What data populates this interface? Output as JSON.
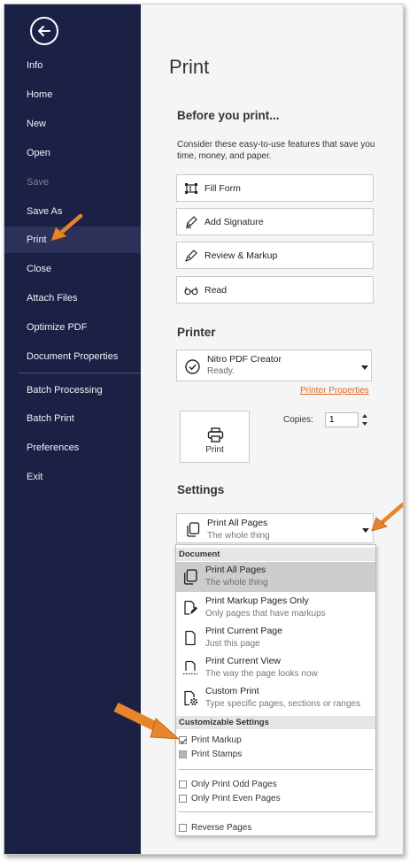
{
  "sidebar": {
    "items": [
      {
        "label": "Info"
      },
      {
        "label": "Home"
      },
      {
        "label": "New"
      },
      {
        "label": "Open"
      },
      {
        "label": "Save"
      },
      {
        "label": "Save As"
      },
      {
        "label": "Print"
      },
      {
        "label": "Close"
      },
      {
        "label": "Attach Files"
      },
      {
        "label": "Optimize PDF"
      },
      {
        "label": "Document Properties"
      },
      {
        "label": "Batch Processing"
      },
      {
        "label": "Batch Print"
      },
      {
        "label": "Preferences"
      },
      {
        "label": "Exit"
      }
    ],
    "active": "Print",
    "disabled": "Save"
  },
  "main": {
    "title": "Print",
    "before_heading": "Before you print...",
    "before_hint": "Consider these easy-to-use features that save you time, money, and paper.",
    "features": [
      {
        "label": "Fill Form",
        "icon": "fill-form-icon"
      },
      {
        "label": "Add Signature",
        "icon": "signature-pen-icon"
      },
      {
        "label": "Review & Markup",
        "icon": "markup-pen-icon"
      },
      {
        "label": "Read",
        "icon": "glasses-icon"
      }
    ],
    "printer_heading": "Printer",
    "printer": {
      "name": "Nitro PDF Creator",
      "status": "Ready."
    },
    "printer_properties_link": "Printer Properties",
    "print_button_label": "Print",
    "copies_label": "Copies:",
    "copies_value": "1",
    "settings_heading": "Settings",
    "settings_selected": {
      "title": "Print All Pages",
      "subtitle": "The whole thing"
    }
  },
  "dropdown": {
    "group_document": "Document",
    "options": [
      {
        "title": "Print All Pages",
        "subtitle": "The whole thing"
      },
      {
        "title": "Print Markup Pages Only",
        "subtitle": "Only pages that have markups"
      },
      {
        "title": "Print Current Page",
        "subtitle": "Just this page"
      },
      {
        "title": "Print Current View",
        "subtitle": "The way the page looks now"
      },
      {
        "title": "Custom Print",
        "subtitle": "Type specific pages, sections or ranges"
      }
    ],
    "group_custom": "Customizable Settings",
    "checks": [
      {
        "label": "Print Markup",
        "checked": true
      },
      {
        "label": "Print Stamps",
        "checked": false
      },
      {
        "label": "Only Print Odd Pages",
        "checked": false
      },
      {
        "label": "Only Print Even Pages",
        "checked": false
      },
      {
        "label": "Reverse Pages",
        "checked": false
      }
    ]
  },
  "colors": {
    "sidebar": "#1b2145",
    "accent_link": "#e26a1c",
    "annotation_arrow": "#e8842a"
  }
}
